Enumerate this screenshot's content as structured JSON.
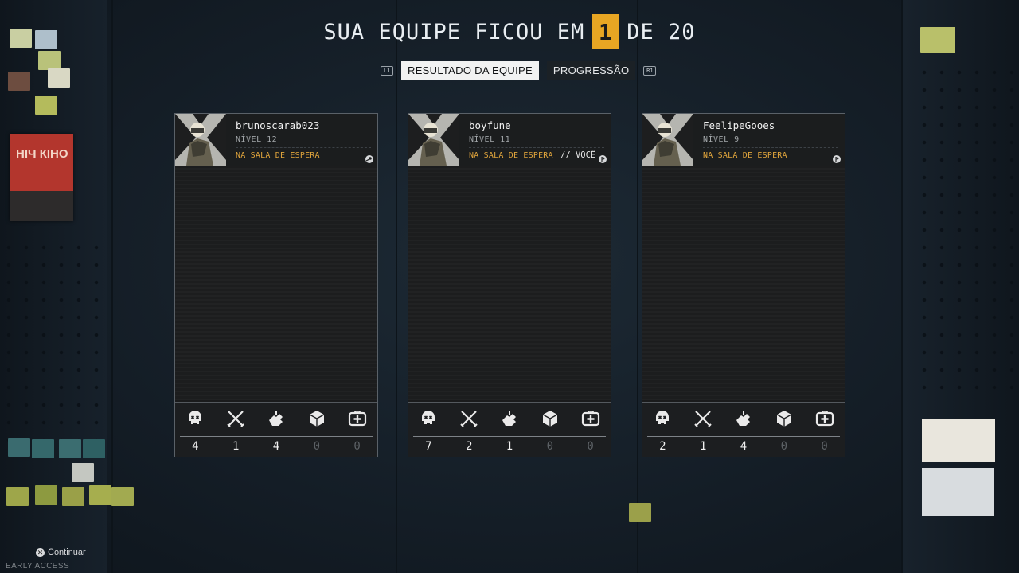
{
  "header": {
    "prefix": "SUA EQUIPE FICOU EM",
    "rank": "1",
    "suffix": "DE 20"
  },
  "tabs": {
    "left_hint": "L1",
    "right_hint": "R1",
    "items": [
      {
        "label": "RESULTADO DA EQUIPE",
        "active": true
      },
      {
        "label": "PROGRESSÃO",
        "active": false
      }
    ]
  },
  "players": [
    {
      "name": "brunoscarab023",
      "level": "NÍVEL 12",
      "status": "NA SALA DE ESPERA",
      "you": "",
      "platform_icon": "steam-icon",
      "stats": [
        "4",
        "1",
        "4",
        "0",
        "0"
      ]
    },
    {
      "name": "boyfune",
      "level": "NÍVEL 11",
      "status": "NA SALA DE ESPERA",
      "you": "// VOCÊ",
      "platform_icon": "playstation-icon",
      "stats": [
        "7",
        "2",
        "1",
        "0",
        "0"
      ]
    },
    {
      "name": "FeelipeGooes",
      "level": "NÍVEL 9",
      "status": "NA SALA DE ESPERA",
      "you": "",
      "platform_icon": "playstation-icon",
      "stats": [
        "2",
        "1",
        "4",
        "0",
        "0"
      ]
    }
  ],
  "stat_icons": [
    "skull-icon",
    "crossed-swords-icon",
    "revive-hand-icon",
    "loot-cube-icon",
    "medkit-icon"
  ],
  "poster": {
    "text": "НІЧ КІНО"
  },
  "footer": {
    "continue_label": "Continuar",
    "early_access": "EARLY ACCESS"
  },
  "colors": {
    "accent": "#e8a623",
    "status": "#e1a53c"
  }
}
